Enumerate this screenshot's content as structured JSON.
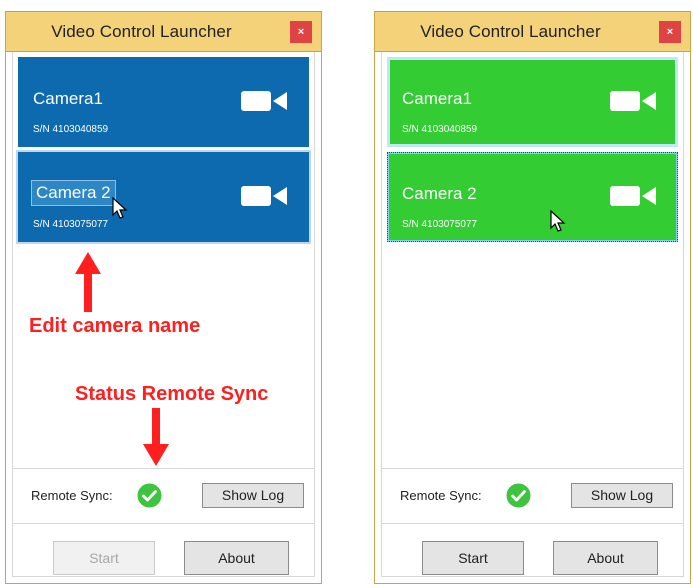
{
  "windows": [
    {
      "title": "Video Control Launcher",
      "close_label": "×",
      "cameras": [
        {
          "name": "Camera1",
          "serial": "S/N 4103040859"
        },
        {
          "name": "Camera 2",
          "serial": "S/N 4103075077"
        }
      ],
      "remote_sync_label": "Remote Sync:",
      "show_log_label": "Show Log",
      "start_label": "Start",
      "about_label": "About",
      "card_color": "#0d6aae"
    },
    {
      "title": "Video Control Launcher",
      "close_label": "×",
      "cameras": [
        {
          "name": "Camera1",
          "serial": "S/N 4103040859"
        },
        {
          "name": "Camera 2",
          "serial": "S/N 4103075077"
        }
      ],
      "remote_sync_label": "Remote Sync:",
      "show_log_label": "Show Log",
      "start_label": "Start",
      "about_label": "About",
      "card_color": "#33cc33"
    }
  ],
  "annotations": {
    "edit_name": "Edit camera name",
    "status_sync": "Status Remote Sync"
  },
  "colors": {
    "titlebar": "#f3d27a",
    "close": "#e04343",
    "check": "#3fc43f",
    "annotation": "#ff1f1f"
  }
}
